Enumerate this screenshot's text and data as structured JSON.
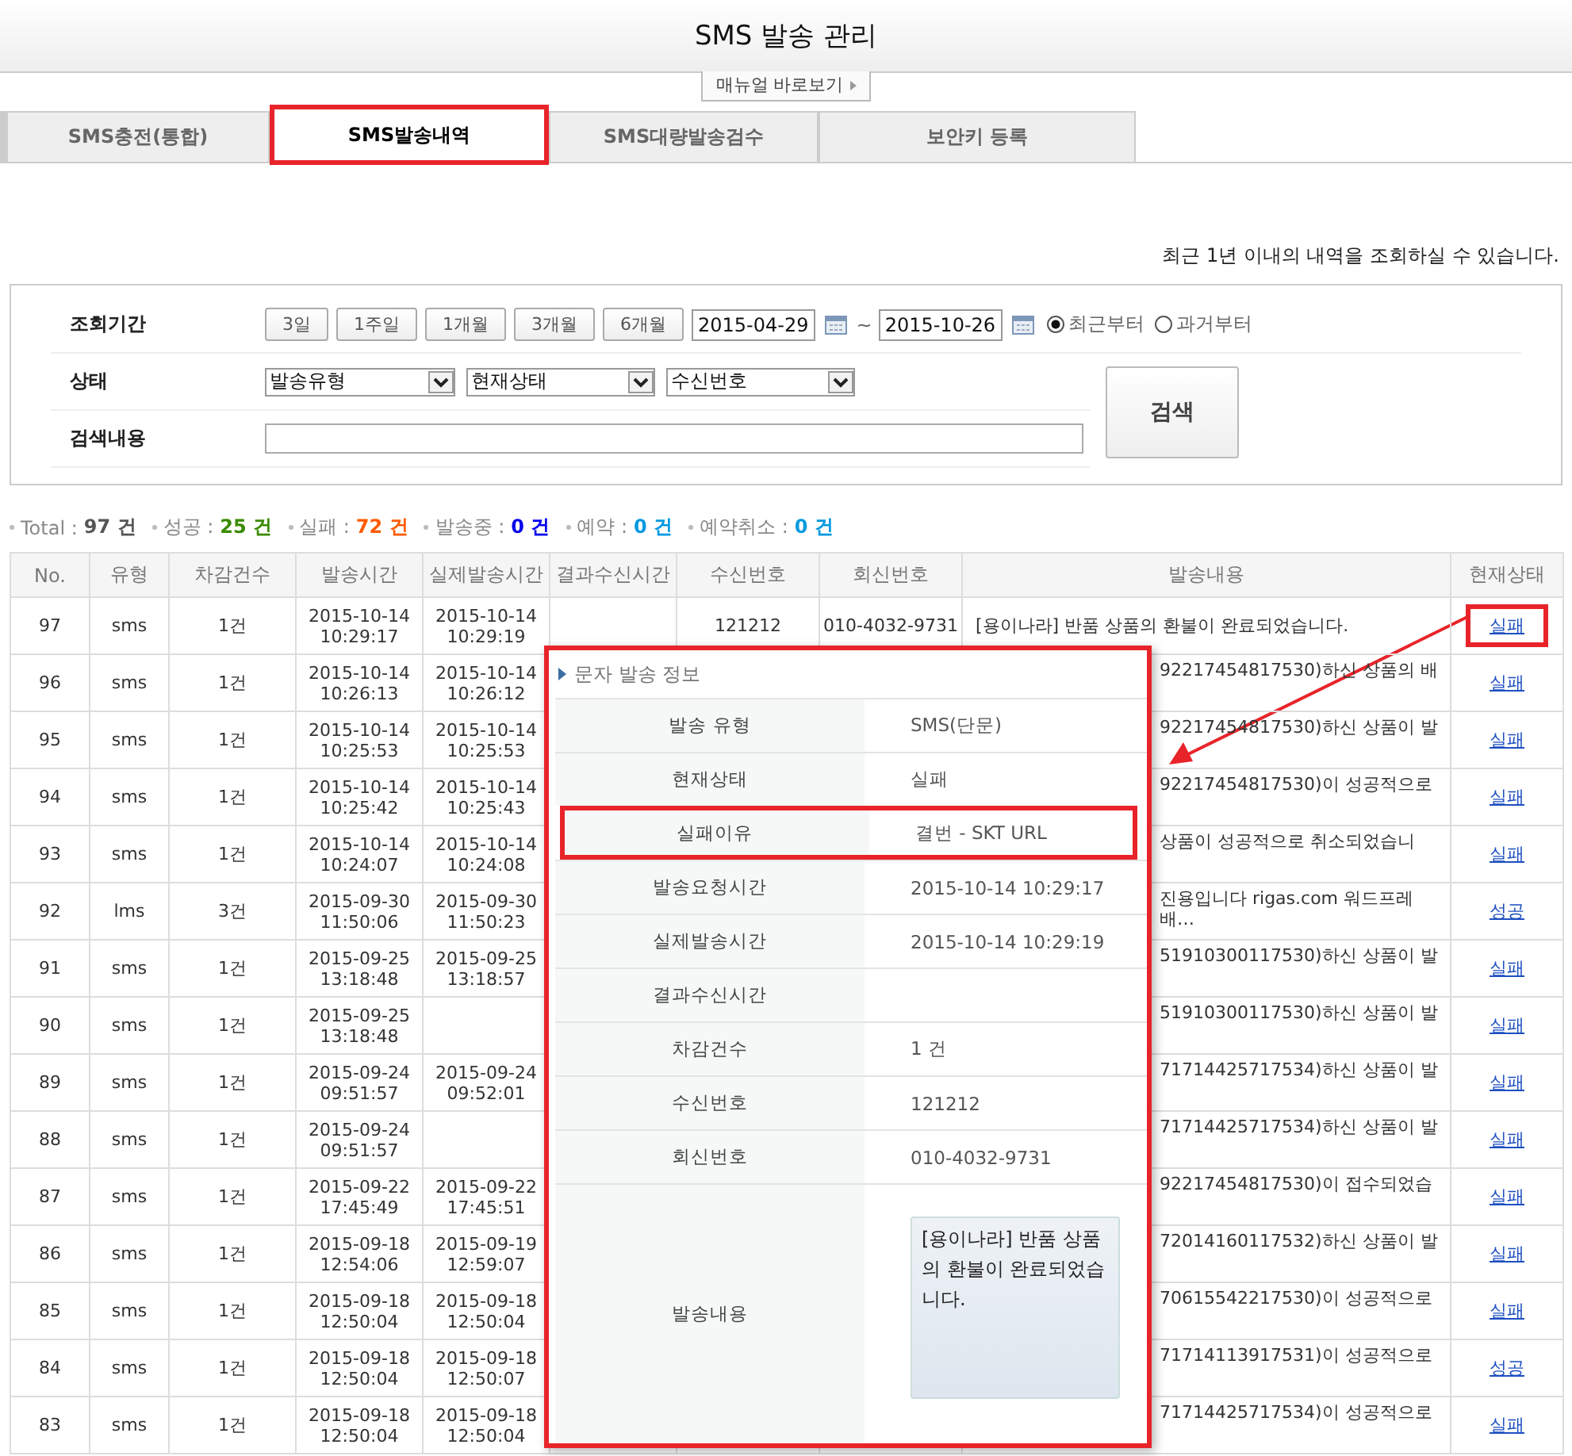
{
  "page_title": "SMS 발송 관리",
  "manual_button": "매뉴얼 바로보기",
  "tabs": [
    {
      "label": "SMS충전(통합)",
      "selected": false
    },
    {
      "label": "SMS발송내역",
      "selected": true
    },
    {
      "label": "SMS대량발송검수",
      "selected": false
    },
    {
      "label": "보안키 등록",
      "selected": false
    }
  ],
  "notice": "최근 1년 이내의 내역을 조회하실 수 있습니다.",
  "filters": {
    "period_label": "조회기간",
    "period_buttons": [
      "3일",
      "1주일",
      "1개월",
      "3개월",
      "6개월"
    ],
    "date_from": "2015-04-29",
    "range_separator": "~",
    "date_to": "2015-10-26",
    "order_options": [
      {
        "label": "최근부터",
        "selected": true
      },
      {
        "label": "과거부터",
        "selected": false
      }
    ],
    "status_label": "상태",
    "selects": [
      "발송유형",
      "현재상태",
      "수신번호"
    ],
    "keyword_label": "검색내용",
    "search_button": "검색"
  },
  "summary": [
    {
      "label": "Total :",
      "value": "97 건",
      "color": "#555555"
    },
    {
      "label": "성공 :",
      "value": "25 건",
      "color": "#3a8a00"
    },
    {
      "label": "실패 :",
      "value": "72 건",
      "color": "#ff5a00"
    },
    {
      "label": "발송중 :",
      "value": "0 건",
      "color": "#0000ee"
    },
    {
      "label": "예약 :",
      "value": "0 건",
      "color": "#0099e0"
    },
    {
      "label": "예약취소 :",
      "value": "0 건",
      "color": "#0099e0"
    }
  ],
  "table": {
    "columns": [
      "No.",
      "유형",
      "차감건수",
      "발송시간",
      "실제발송시간",
      "결과수신시간",
      "수신번호",
      "회신번호",
      "발송내용",
      "현재상태"
    ],
    "rows": [
      {
        "no": "97",
        "type": "sms",
        "count": "1건",
        "sent_time": "2015-10-14 10:29:17",
        "actual_time": "2015-10-14 10:29:19",
        "receiver": "121212",
        "reply": "010-4032-9731",
        "content": "[용이나라] 반품 상품의 환불이 완료되었습니다.",
        "status": "실패",
        "highlighted": true,
        "covered": false
      },
      {
        "no": "96",
        "type": "sms",
        "count": "1건",
        "sent_time": "2015-10-14 10:26:13",
        "actual_time": "2015-10-14 10:26:12",
        "content": "92217454817530)하신 상품의 배",
        "status": "실패",
        "highlighted": false,
        "covered": true
      },
      {
        "no": "95",
        "type": "sms",
        "count": "1건",
        "sent_time": "2015-10-14 10:25:53",
        "actual_time": "2015-10-14 10:25:53",
        "content": "92217454817530)하신 상품이 발",
        "status": "실패",
        "highlighted": false,
        "covered": true
      },
      {
        "no": "94",
        "type": "sms",
        "count": "1건",
        "sent_time": "2015-10-14 10:25:42",
        "actual_time": "2015-10-14 10:25:43",
        "content": "92217454817530)이 성공적으로",
        "status": "실패",
        "highlighted": false,
        "covered": true
      },
      {
        "no": "93",
        "type": "sms",
        "count": "1건",
        "sent_time": "2015-10-14 10:24:07",
        "actual_time": "2015-10-14 10:24:08",
        "content": "상품이 성공적으로 취소되었습니",
        "status": "실패",
        "highlighted": false,
        "covered": true
      },
      {
        "no": "92",
        "type": "lms",
        "count": "3건",
        "sent_time": "2015-09-30 11:50:06",
        "actual_time": "2015-09-30 11:50:23",
        "content": "진용입니다 rigas.com 워드프레\n배…",
        "status": "성공",
        "highlighted": false,
        "covered": true
      },
      {
        "no": "91",
        "type": "sms",
        "count": "1건",
        "sent_time": "2015-09-25 13:18:48",
        "actual_time": "2015-09-25 13:18:57",
        "content": "51910300117530)하신 상품이 발",
        "status": "실패",
        "highlighted": false,
        "covered": true
      },
      {
        "no": "90",
        "type": "sms",
        "count": "1건",
        "sent_time": "2015-09-25 13:18:48",
        "content": "51910300117530)하신 상품이 발",
        "status": "실패",
        "highlighted": false,
        "covered": true
      },
      {
        "no": "89",
        "type": "sms",
        "count": "1건",
        "sent_time": "2015-09-24 09:51:57",
        "actual_time": "2015-09-24 09:52:01",
        "content": "71714425717534)하신 상품이 발",
        "status": "실패",
        "highlighted": false,
        "covered": true
      },
      {
        "no": "88",
        "type": "sms",
        "count": "1건",
        "sent_time": "2015-09-24 09:51:57",
        "content": "71714425717534)하신 상품이 발",
        "status": "실패",
        "highlighted": false,
        "covered": true
      },
      {
        "no": "87",
        "type": "sms",
        "count": "1건",
        "sent_time": "2015-09-22 17:45:49",
        "actual_time": "2015-09-22 17:45:51",
        "content": "92217454817530)이 접수되었습",
        "status": "실패",
        "highlighted": false,
        "covered": true
      },
      {
        "no": "86",
        "type": "sms",
        "count": "1건",
        "sent_time": "2015-09-18 12:54:06",
        "actual_time": "2015-09-19 12:59:07",
        "content": "72014160117532)하신 상품이 발",
        "status": "실패",
        "highlighted": false,
        "covered": true
      },
      {
        "no": "85",
        "type": "sms",
        "count": "1건",
        "sent_time": "2015-09-18 12:50:04",
        "actual_time": "2015-09-18 12:50:04",
        "content": "70615542217530)이 성공적으로",
        "status": "실패",
        "highlighted": false,
        "covered": true
      },
      {
        "no": "84",
        "type": "sms",
        "count": "1건",
        "sent_time": "2015-09-18 12:50:04",
        "actual_time": "2015-09-18 12:50:07",
        "content": "71714113917531)이 성공적으로",
        "status": "성공",
        "highlighted": false,
        "covered": true
      },
      {
        "no": "83",
        "type": "sms",
        "count": "1건",
        "sent_time": "2015-09-18 12:50:04",
        "actual_time": "2015-09-18 12:50:04",
        "content": "71714425717534)이 성공적으로",
        "status": "실패",
        "highlighted": false,
        "covered": true
      }
    ]
  },
  "popup": {
    "title": "문자 발송 정보",
    "rows": [
      {
        "label": "발송 유형",
        "value": "SMS(단문)",
        "kind": "text",
        "highlighted": false
      },
      {
        "label": "현재상태",
        "value": "실패",
        "kind": "text",
        "highlighted": false
      },
      {
        "label": "실패이유",
        "value": "결번 - SKT URL",
        "kind": "text",
        "highlighted": true
      },
      {
        "label": "발송요청시간",
        "value": "2015-10-14 10:29:17",
        "kind": "text",
        "highlighted": false
      },
      {
        "label": "실제발송시간",
        "value": "2015-10-14 10:29:19",
        "kind": "text",
        "highlighted": false
      },
      {
        "label": "결과수신시간",
        "kind": "text",
        "highlighted": false
      },
      {
        "label": "차감건수",
        "value": "1 건",
        "kind": "text",
        "highlighted": false
      },
      {
        "label": "수신번호",
        "value": "121212",
        "kind": "text",
        "highlighted": false
      },
      {
        "label": "회신번호",
        "value": "010-4032-9731",
        "kind": "text",
        "highlighted": false
      },
      {
        "label": "발송내용",
        "value": "[용이나라] 반품 상품의 환불이 완료되었습니다.",
        "kind": "message",
        "highlighted": false
      }
    ]
  }
}
